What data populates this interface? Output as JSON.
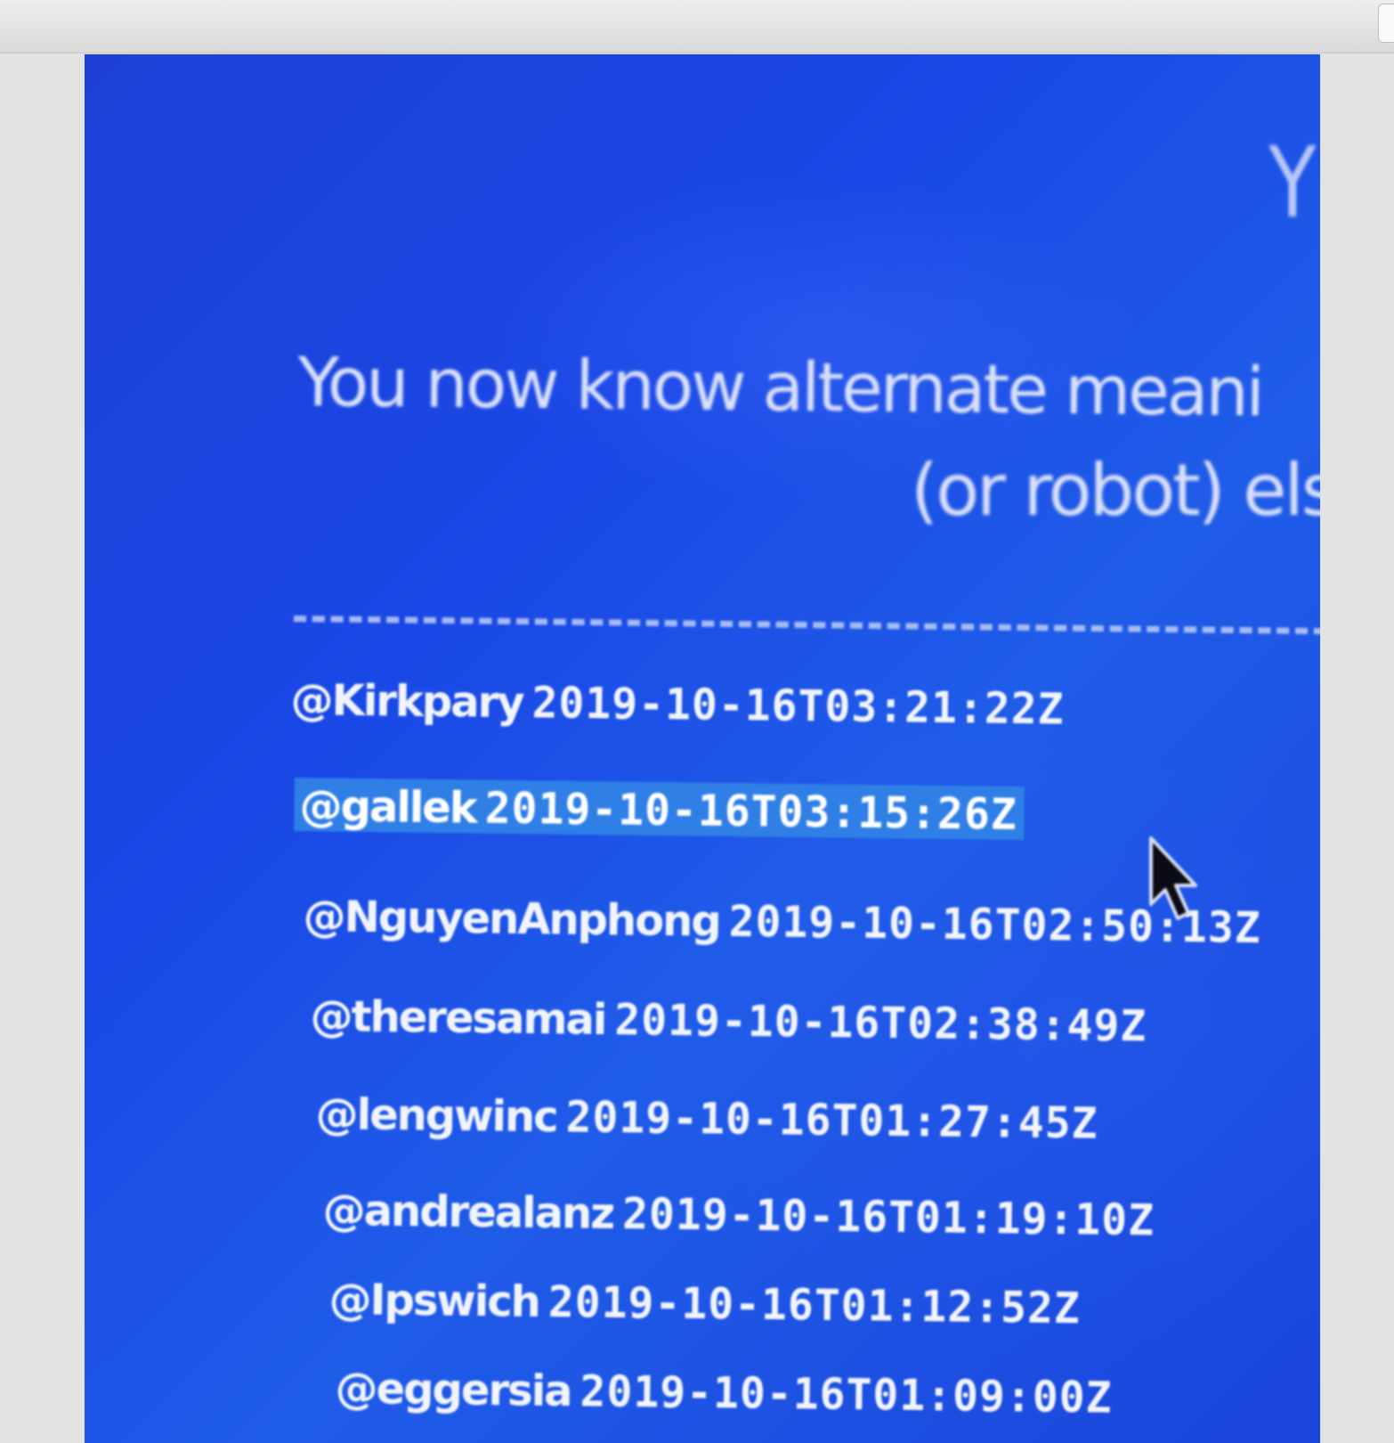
{
  "page": {
    "headline_line1": "You now know alternate meani",
    "headline_line2": "(or robot) els",
    "corner_text": "Y"
  },
  "entries": [
    {
      "user": "@Kirkpary",
      "time": "2019-10-16T03:21:22Z",
      "selected": false
    },
    {
      "user": "@gallek",
      "time": "2019-10-16T03:15:26Z",
      "selected": true
    },
    {
      "user": "@NguyenAnphong",
      "time": "2019-10-16T02:50:13Z",
      "selected": false
    },
    {
      "user": "@theresamai",
      "time": "2019-10-16T02:38:49Z",
      "selected": false
    },
    {
      "user": "@lengwinc",
      "time": "2019-10-16T01:27:45Z",
      "selected": false
    },
    {
      "user": "@andrealanz",
      "time": "2019-10-16T01:19:10Z",
      "selected": false
    },
    {
      "user": "@Ipswich",
      "time": "2019-10-16T01:12:52Z",
      "selected": false
    },
    {
      "user": "@eggersia",
      "time": "2019-10-16T01:09:00Z",
      "selected": false
    }
  ],
  "colors": {
    "screen_blue": "#1a48e6",
    "selection_highlight": "#2f7fe6",
    "text": "#f1f4fb"
  },
  "icons": {
    "cursor": "mouse-pointer-arrow-icon"
  }
}
